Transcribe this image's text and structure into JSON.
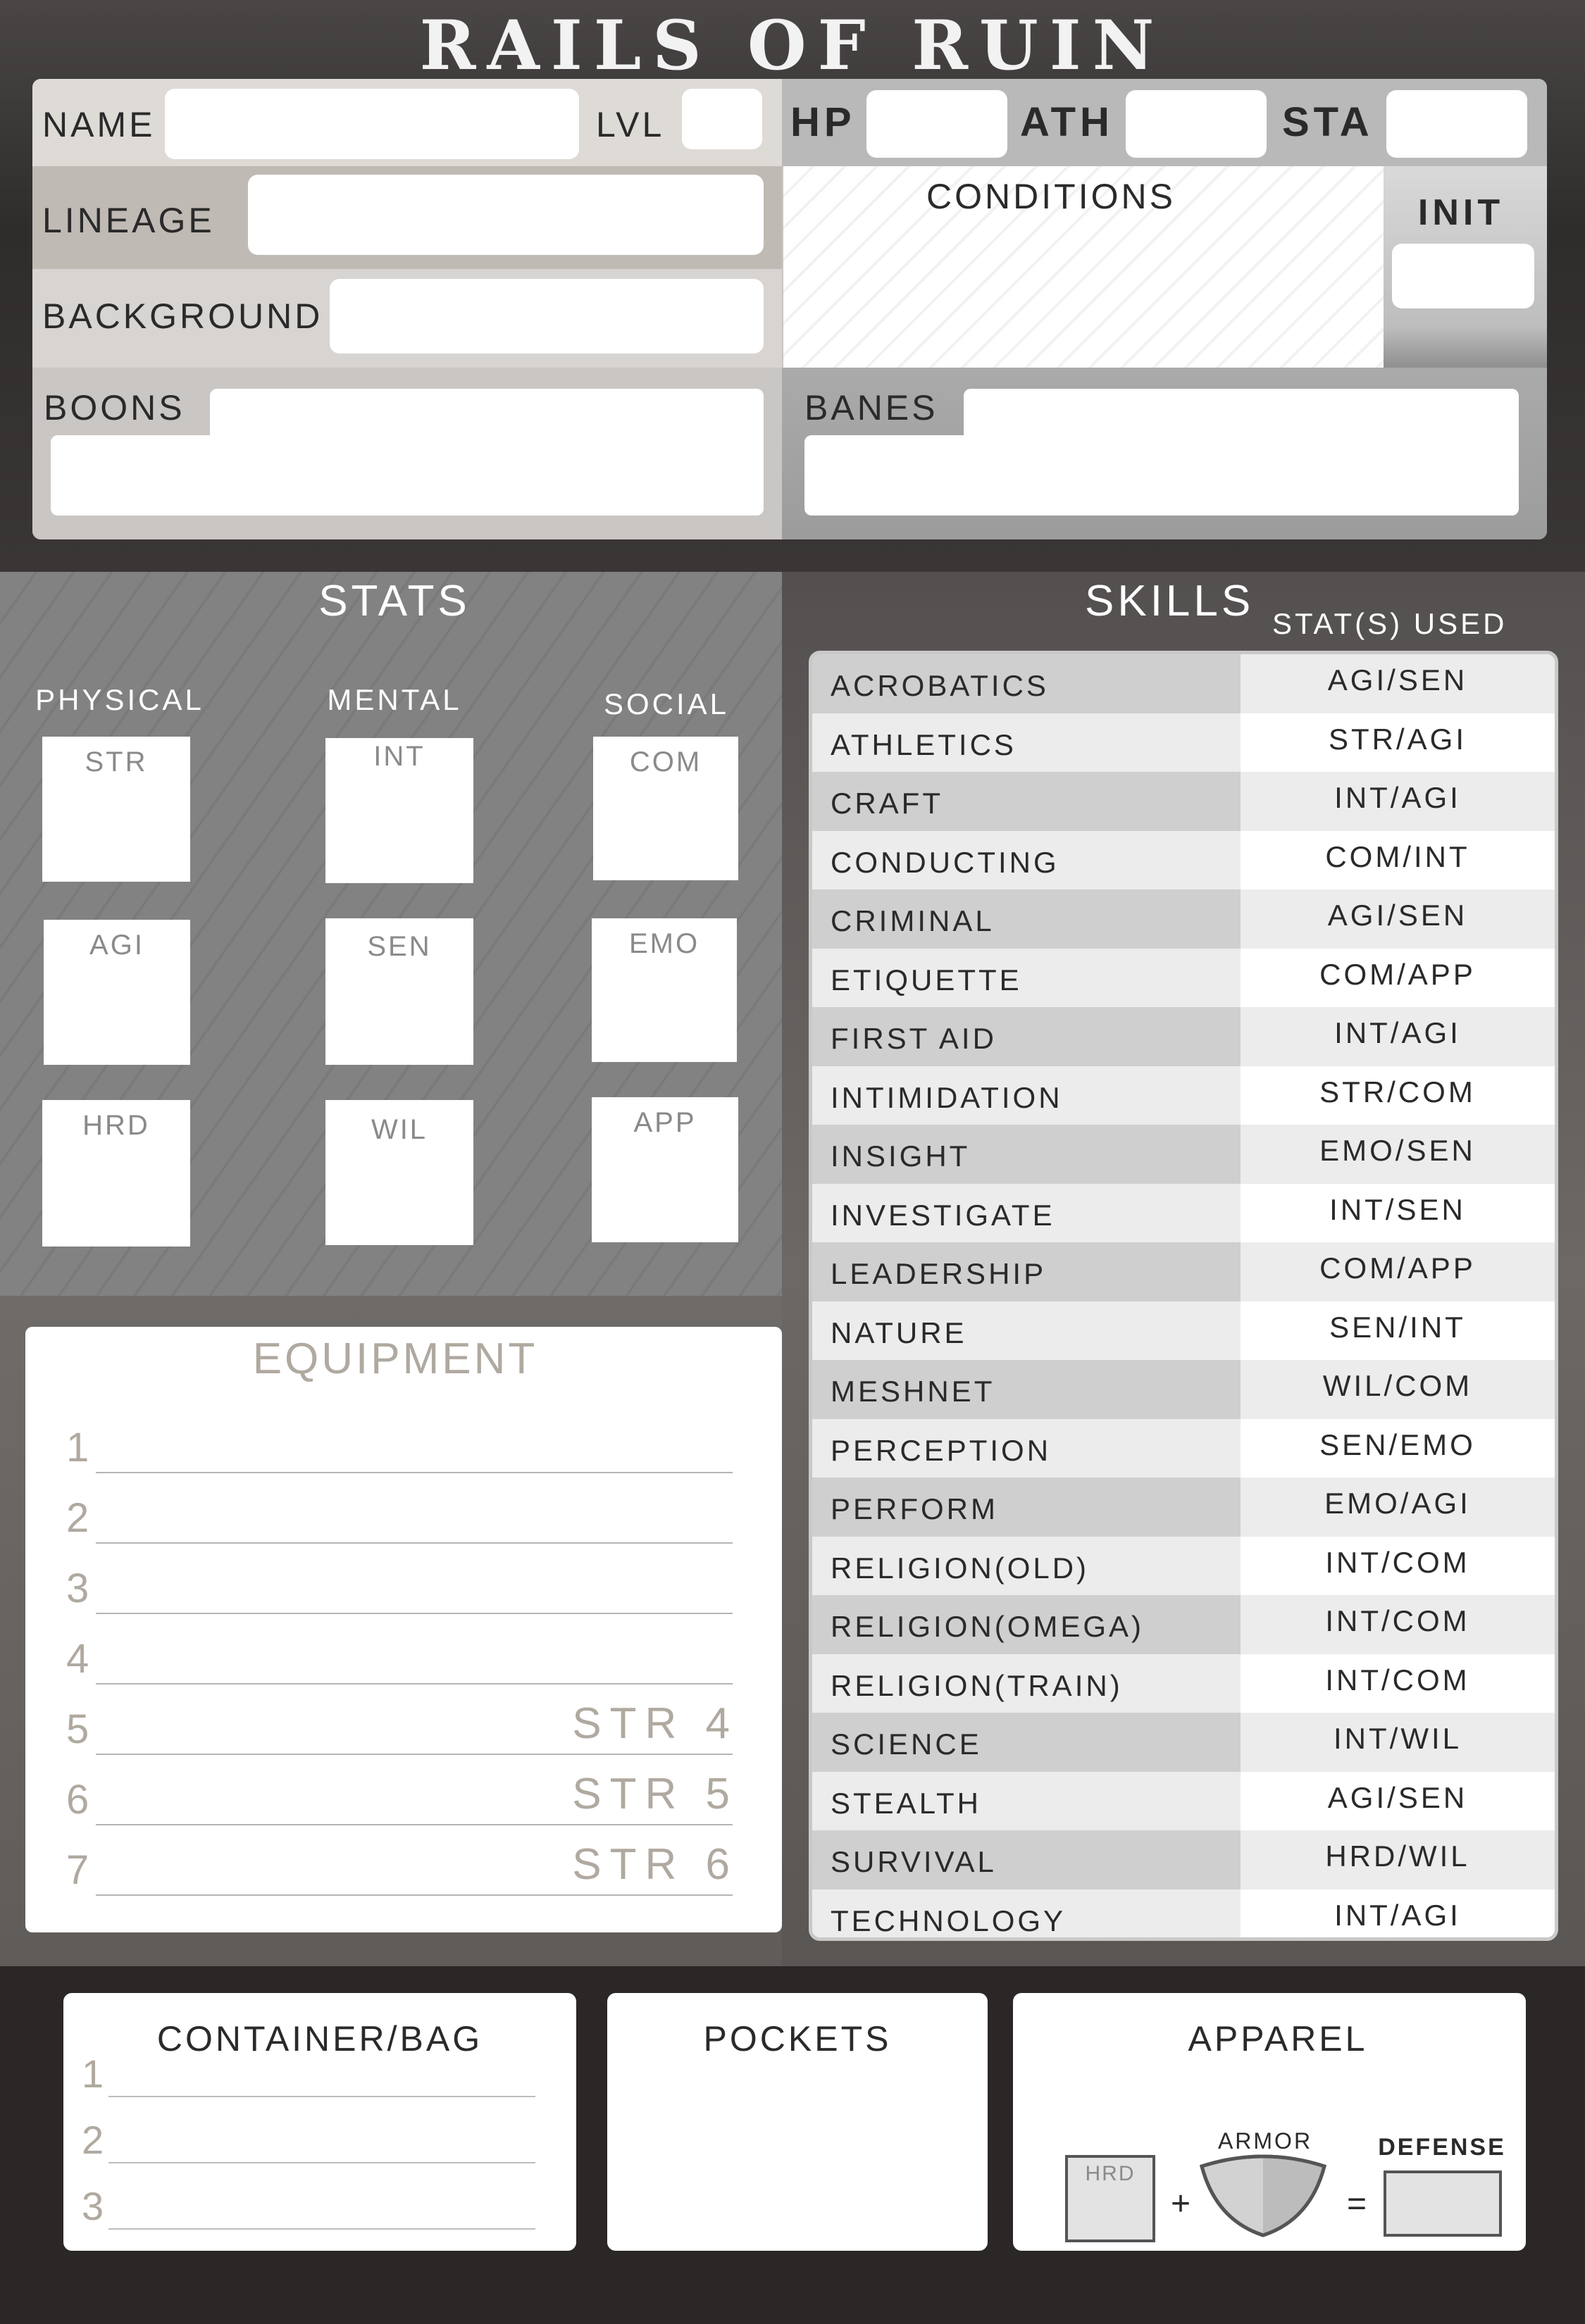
{
  "title": "RAILS OF RUIN",
  "header": {
    "name_label": "NAME",
    "lvl_label": "LVL",
    "hp_label": "HP",
    "ath_label": "ATH",
    "sta_label": "STA",
    "lineage_label": "LINEAGE",
    "background_label": "BACKGROUND",
    "conditions_label": "CONDITIONS",
    "init_label": "INIT",
    "boons_label": "BOONS",
    "banes_label": "BANES"
  },
  "stats": {
    "title": "STATS",
    "categories": [
      "PHYSICAL",
      "MENTAL",
      "SOCIAL"
    ],
    "physical": [
      "STR",
      "AGI",
      "HRD"
    ],
    "mental": [
      "INT",
      "SEN",
      "WIL"
    ],
    "social": [
      "COM",
      "EMO",
      "APP"
    ]
  },
  "skills": {
    "title": "SKILLS",
    "stats_used_label": "STAT(S) USED",
    "rows": [
      {
        "name": "ACROBATICS",
        "stats": "AGI/SEN"
      },
      {
        "name": "ATHLETICS",
        "stats": "STR/AGI"
      },
      {
        "name": "CRAFT",
        "stats": "INT/AGI"
      },
      {
        "name": "CONDUCTING",
        "stats": "COM/INT"
      },
      {
        "name": "CRIMINAL",
        "stats": "AGI/SEN"
      },
      {
        "name": "ETIQUETTE",
        "stats": "COM/APP"
      },
      {
        "name": "FIRST AID",
        "stats": "INT/AGI"
      },
      {
        "name": "INTIMIDATION",
        "stats": "STR/COM"
      },
      {
        "name": "INSIGHT",
        "stats": "EMO/SEN"
      },
      {
        "name": "INVESTIGATE",
        "stats": "INT/SEN"
      },
      {
        "name": "LEADERSHIP",
        "stats": "COM/APP"
      },
      {
        "name": "NATURE",
        "stats": "SEN/INT"
      },
      {
        "name": "MESHNET",
        "stats": "WIL/COM"
      },
      {
        "name": "PERCEPTION",
        "stats": "SEN/EMO"
      },
      {
        "name": "PERFORM",
        "stats": "EMO/AGI"
      },
      {
        "name": "RELIGION(OLD)",
        "stats": "INT/COM"
      },
      {
        "name": "RELIGION(OMEGA)",
        "stats": "INT/COM"
      },
      {
        "name": "RELIGION(TRAIN)",
        "stats": "INT/COM"
      },
      {
        "name": "SCIENCE",
        "stats": "INT/WIL"
      },
      {
        "name": "STEALTH",
        "stats": "AGI/SEN"
      },
      {
        "name": "SURVIVAL",
        "stats": "HRD/WIL"
      },
      {
        "name": "TECHNOLOGY",
        "stats": "INT/AGI"
      }
    ]
  },
  "equipment": {
    "title": "EQUIPMENT",
    "numbers": [
      "1",
      "2",
      "3",
      "4",
      "5",
      "6",
      "7"
    ],
    "str_req": [
      "STR 4",
      "STR 5",
      "STR 6"
    ]
  },
  "container": {
    "title": "CONTAINER/BAG",
    "numbers": [
      "1",
      "2",
      "3"
    ]
  },
  "pockets": {
    "title": "POCKETS"
  },
  "apparel": {
    "title": "APPAREL",
    "hrd_label": "HRD",
    "plus": "+",
    "armor_label": "ARMOR",
    "equals": "=",
    "defense_label": "DEFENSE"
  },
  "colors": {
    "page_dark": "#2b2726",
    "header_frame": "#333333",
    "stats_panel": "#7f7f7f",
    "skills_panel": "#5f5b59",
    "row_dark": "#cfcfcf",
    "row_light": "#ececec",
    "faint_text": "#b0a9a0"
  }
}
